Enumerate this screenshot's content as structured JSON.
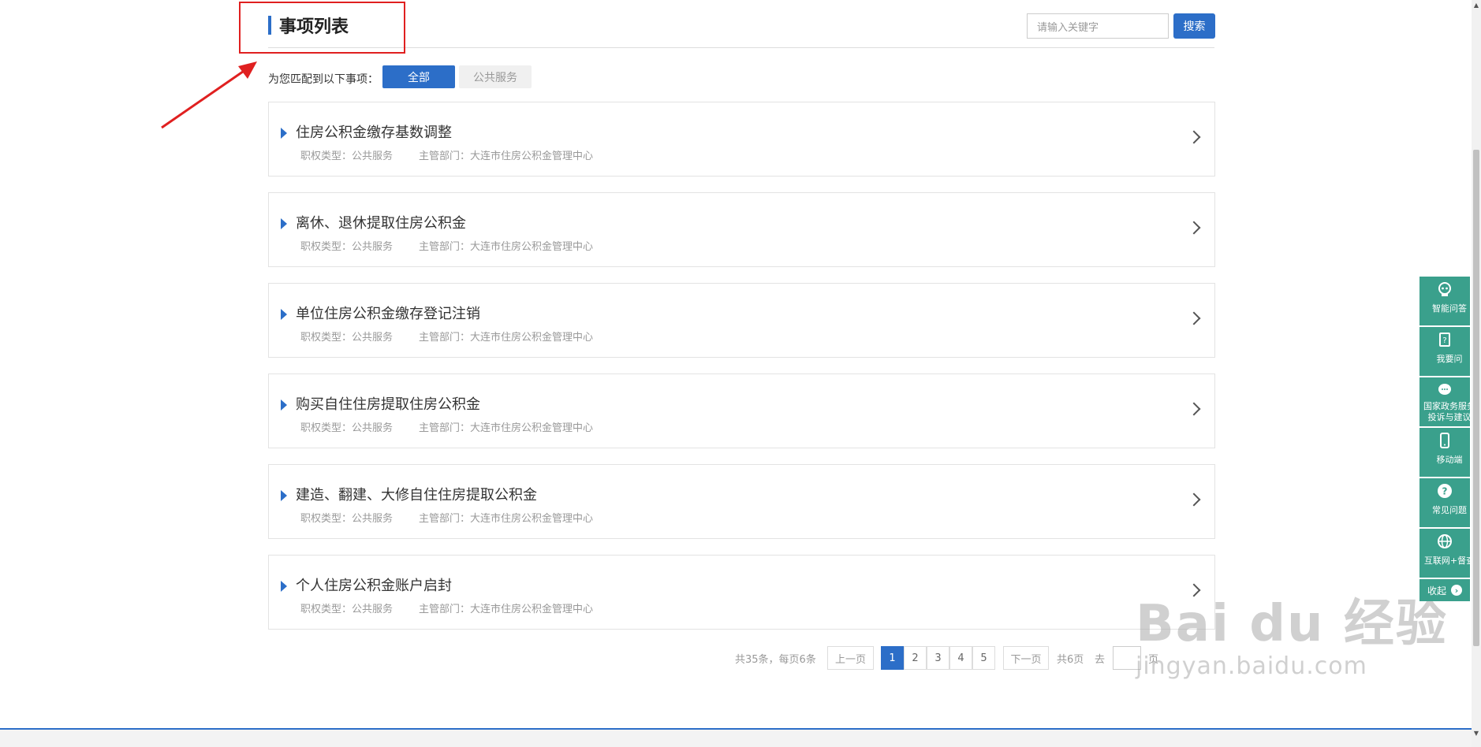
{
  "header": {
    "title": "事项列表",
    "search_placeholder": "请输入关键字",
    "search_button": "搜索"
  },
  "filter": {
    "label": "为您匹配到以下事项：",
    "tabs": [
      {
        "label": "全部",
        "active": true
      },
      {
        "label": "公共服务",
        "active": false
      }
    ]
  },
  "items": [
    {
      "name": "住房公积金缴存基数调整",
      "type": "职权类型：公共服务",
      "dept": "主管部门：大连市住房公积金管理中心"
    },
    {
      "name": "离休、退休提取住房公积金",
      "type": "职权类型：公共服务",
      "dept": "主管部门：大连市住房公积金管理中心"
    },
    {
      "name": "单位住房公积金缴存登记注销",
      "type": "职权类型：公共服务",
      "dept": "主管部门：大连市住房公积金管理中心"
    },
    {
      "name": "购买自住住房提取住房公积金",
      "type": "职权类型：公共服务",
      "dept": "主管部门：大连市住房公积金管理中心"
    },
    {
      "name": "建造、翻建、大修自住住房提取公积金",
      "type": "职权类型：公共服务",
      "dept": "主管部门：大连市住房公积金管理中心"
    },
    {
      "name": "个人住房公积金账户启封",
      "type": "职权类型：公共服务",
      "dept": "主管部门：大连市住房公积金管理中心"
    }
  ],
  "pagination": {
    "summary": "共35条，每页6条",
    "prev": "上一页",
    "pages": [
      "1",
      "2",
      "3",
      "4",
      "5"
    ],
    "current": "1",
    "next": "下一页",
    "total_pages": "共6页",
    "goto": "去",
    "page_unit": "页"
  },
  "side_panel": {
    "items": [
      {
        "label": "智能问答",
        "icon": "robot-icon"
      },
      {
        "label": "我要问",
        "icon": "question-clipboard-icon"
      },
      {
        "label": "国家政务服务投诉与建议",
        "icon": "chat-bubble-icon"
      },
      {
        "label": "移动端",
        "icon": "mobile-icon"
      },
      {
        "label": "常见问题",
        "icon": "help-circle-icon"
      },
      {
        "label": "互联网+督查",
        "icon": "globe-icon"
      }
    ],
    "collapse": "收起"
  },
  "watermark": {
    "logo": "Bai du 经验",
    "url": "jingyan.baidu.com"
  },
  "colors": {
    "accent": "#2c6ec8",
    "side_panel": "#3aa08c",
    "highlight": "#e02020"
  }
}
